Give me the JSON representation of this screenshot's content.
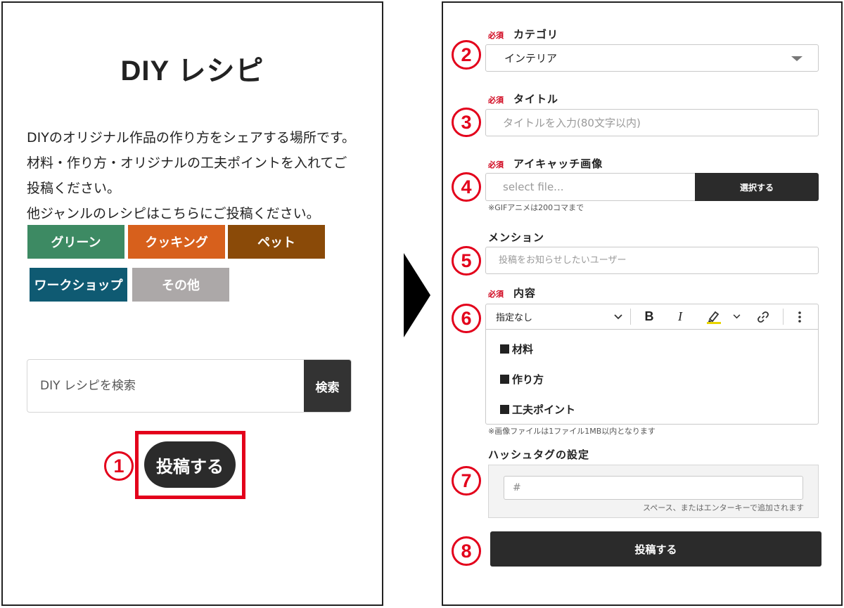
{
  "left": {
    "title": "DIY レシピ",
    "intro_lines": [
      "DIYのオリジナル作品の作り方をシェアする場所です。",
      "材料・作り方・オリジナルの工夫ポイントを入れてご",
      "投稿ください。",
      "他ジャンルのレシピはこちらにご投稿ください。"
    ],
    "genres": [
      {
        "label": "グリーン",
        "color": "#3d8a63"
      },
      {
        "label": "クッキング",
        "color": "#d7601c"
      },
      {
        "label": "ペット",
        "color": "#8a4a08"
      },
      {
        "label": "ワークショップ",
        "color": "#0f5a72"
      },
      {
        "label": "その他",
        "color": "#aca8a8"
      }
    ],
    "search": {
      "placeholder": "DIY レシピを検索",
      "button": "検索"
    },
    "post_button": "投稿する",
    "step_number": "1"
  },
  "right": {
    "required_tag": "必須",
    "category": {
      "label": "カテゴリ",
      "value": "インテリア",
      "step": "2"
    },
    "title_field": {
      "label": "タイトル",
      "placeholder": "タイトルを入力(80文字以内)",
      "step": "3"
    },
    "eyecatch": {
      "label": "アイキャッチ画像",
      "placeholder": "select file...",
      "button": "選択する",
      "note": "※GIFアニメは200コマまで",
      "step": "4"
    },
    "mention": {
      "label": "メンション",
      "placeholder": "投稿をお知らせしたいユーザー",
      "step": "5"
    },
    "content": {
      "label": "内容",
      "step": "6",
      "toolbar": {
        "format_select": "指定なし",
        "bold": "B",
        "italic": "I"
      },
      "lines": [
        "材料",
        "作り方",
        "工夫ポイント"
      ],
      "note": "※画像ファイルは1ファイル1MB以内となります"
    },
    "hashtag": {
      "label": "ハッシュタグの設定",
      "placeholder": "#",
      "hint": "スペース、またはエンターキーで追加されます",
      "step": "7"
    },
    "submit": {
      "label": "投稿する",
      "step": "8"
    }
  },
  "colors": {
    "accent_red": "#e3001b",
    "required_red": "#d0021b",
    "dark_button": "#2b2b2b"
  }
}
